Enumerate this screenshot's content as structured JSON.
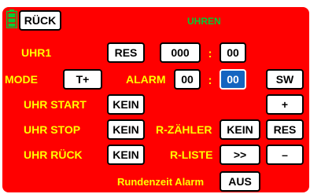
{
  "header": {
    "back_label": "RÜCK",
    "title": "UHREN",
    "battery_icon": "battery-icon",
    "battery_color": "#00cc33"
  },
  "clock1": {
    "label": "UHR1",
    "reset_label": "RES",
    "value": "000",
    "separator": ":",
    "seconds": "00"
  },
  "mode": {
    "label": "MODE",
    "value": "T+",
    "alarm_label": "ALARM",
    "alarm_min": "00",
    "separator": ":",
    "alarm_sec": "00"
  },
  "switch_header": "SW",
  "plus_label": "+",
  "minus_label": "–",
  "start": {
    "label": "UHR START",
    "value": "KEIN"
  },
  "stop": {
    "label": "UHR STOP",
    "value": "KEIN"
  },
  "back_row": {
    "label": "UHR RÜCK",
    "value": "KEIN"
  },
  "lap_counter": {
    "label": "R-ZÄHLER",
    "value": "KEIN",
    "reset_label": "RES"
  },
  "lap_list": {
    "label": "R-LISTE",
    "value": ">>"
  },
  "lap_alarm": {
    "label": "Rundenzeit Alarm",
    "value": "AUS"
  },
  "colors": {
    "background": "#ff0000",
    "label": "#ffff00",
    "title": "#00cc33",
    "selected": "#1565c0"
  }
}
